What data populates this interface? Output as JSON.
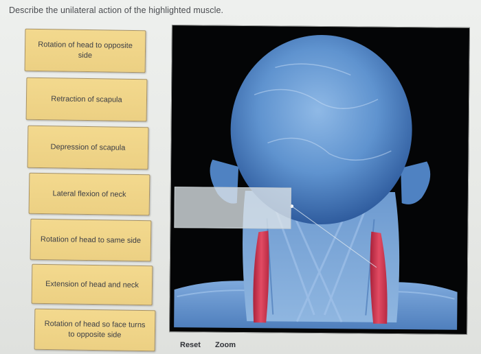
{
  "question": "Describe the unilateral action of the highlighted muscle.",
  "choices": [
    "Rotation of head to opposite side",
    "Retraction of scapula",
    "Depression of scapula",
    "Lateral flexion of neck",
    "Rotation of head to same side",
    "Extension of head and neck",
    "Rotation of head so face turns to opposite side"
  ],
  "controls": {
    "reset": "Reset",
    "zoom": "Zoom"
  },
  "colors": {
    "choice_fill": "#f0d488",
    "choice_border": "#a89160",
    "image_background": "#040506",
    "highlighted_muscle": "#d13a52",
    "specimen_blue": "#6f9fd0"
  }
}
